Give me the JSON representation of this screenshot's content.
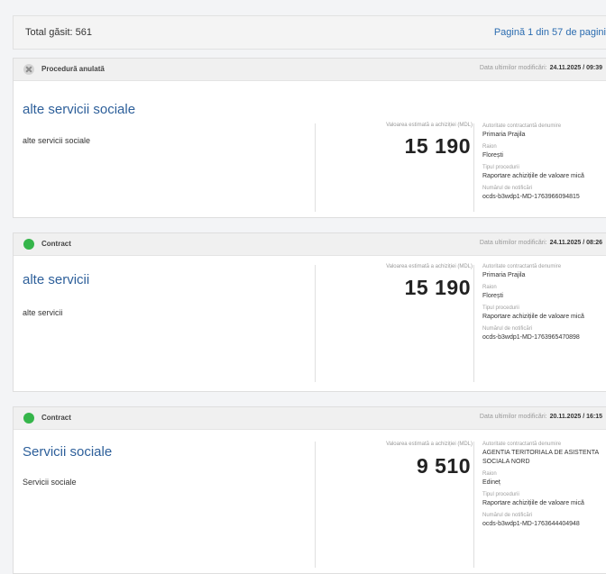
{
  "summary": {
    "total": "Total găsit: 561",
    "pagination": "Pagină 1 din 57 de pagini"
  },
  "labels": {
    "modified": "Data ultimilor modificări:",
    "value": "Valoarea estimată a achiziției (MDL)",
    "authority": "Autoritate contractantă denumire",
    "district": "Raion",
    "procedure_type": "Tipul procedurii",
    "notice_number": "Numărul de notificări"
  },
  "results": [
    {
      "status": "Procedură anulată",
      "modified_date": "24.11.2025 / 09:39",
      "title": "alte servicii sociale",
      "description": "alte servicii sociale",
      "value": "15 190",
      "authority": "Primaria Prajila",
      "district": "Florești",
      "procedure_type": "Raportare achizițiile de valoare mică",
      "notice_number": "ocds-b3wdp1-MD-1763966094815"
    },
    {
      "status": "Contract",
      "modified_date": "24.11.2025 / 08:26",
      "title": "alte servicii",
      "description": "alte servicii",
      "value": "15 190",
      "authority": "Primaria Prajila",
      "district": "Florești",
      "procedure_type": "Raportare achizițiile de valoare mică",
      "notice_number": "ocds-b3wdp1-MD-1763965470898"
    },
    {
      "status": "Contract",
      "modified_date": "20.11.2025 / 16:15",
      "title": "Servicii sociale",
      "description": "Servicii sociale",
      "value": "9 510",
      "authority": "AGENTIA TERITORIALA DE ASISTENTA SOCIALA NORD",
      "district": "Edineț",
      "procedure_type": "Raportare achizițiile de valoare mică",
      "notice_number": "ocds-b3wdp1-MD-1763644404948"
    }
  ],
  "colors": {
    "contract_status": "#35b54a",
    "cancelled_status": "#d4d4d4",
    "link": "#2d5f9a"
  }
}
